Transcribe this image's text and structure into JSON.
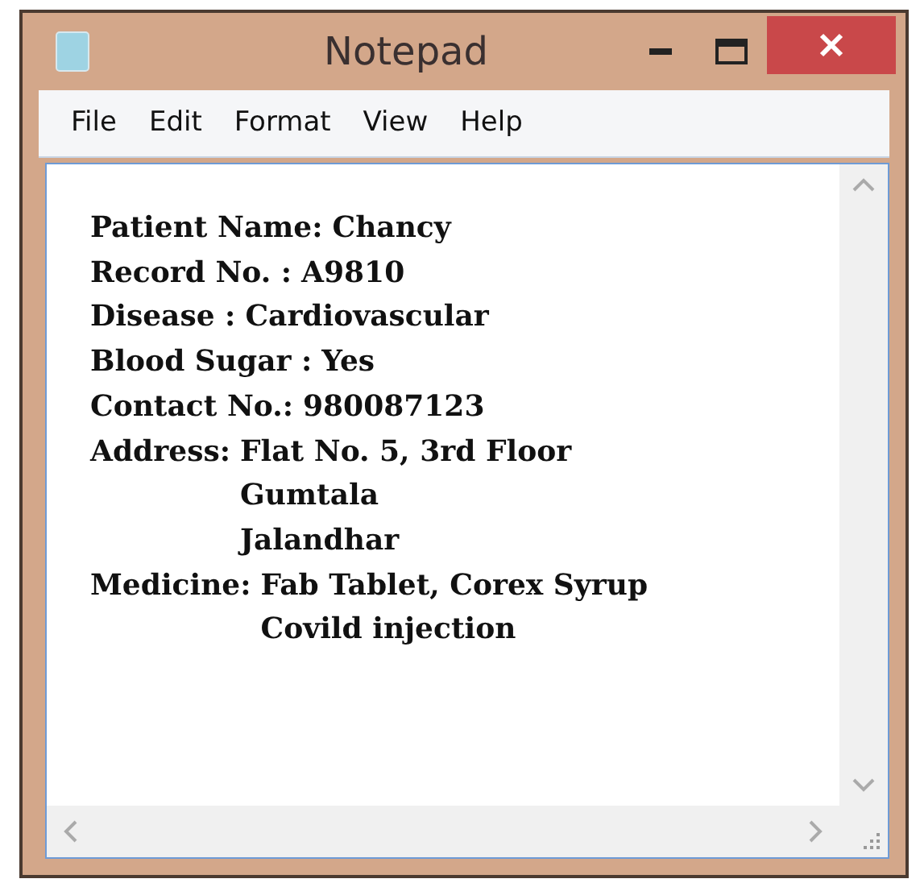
{
  "window": {
    "title": "Notepad"
  },
  "menu": [
    "File",
    "Edit",
    "Format",
    "View",
    "Help"
  ],
  "document": {
    "fields": [
      {
        "label": "Patient Name:",
        "values": [
          "Chancy"
        ]
      },
      {
        "label": "Record No. :",
        "values": [
          "A9810"
        ]
      },
      {
        "label": "Disease :",
        "values": [
          "Cardiovascular"
        ]
      },
      {
        "label": "Blood Sugar :",
        "values": [
          "Yes"
        ]
      },
      {
        "label": "Contact No.:",
        "values": [
          "980087123"
        ]
      },
      {
        "label": "Address:",
        "values": [
          "Flat No. 5, 3rd Floor",
          "Gumtala",
          "Jalandhar"
        ]
      },
      {
        "label": "Medicine:",
        "values": [
          "Fab Tablet, Corex Syrup",
          "Covild injection"
        ]
      }
    ]
  }
}
